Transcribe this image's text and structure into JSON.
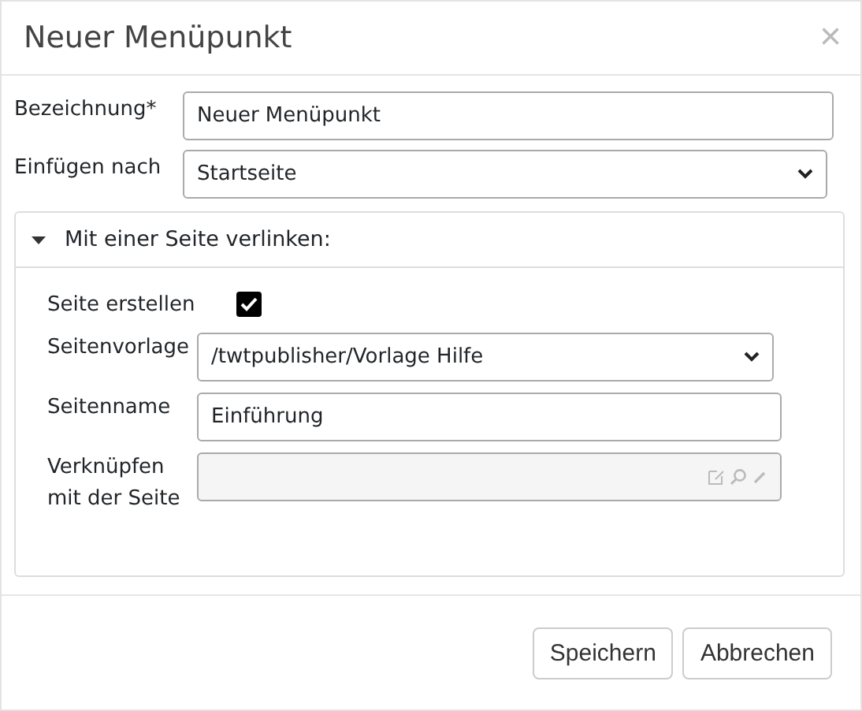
{
  "dialog": {
    "title": "Neuer Menüpunkt",
    "close": "×"
  },
  "fields": [
    {
      "kind": "text",
      "label": "Bezeichnung*",
      "value": "Neuer Menüpunkt"
    },
    {
      "kind": "select",
      "label": "Einfügen nach",
      "value": "Startseite"
    }
  ],
  "panel": {
    "title": "Mit einer Seite verlinken:",
    "expanded": true,
    "rows": [
      {
        "kind": "checkbox",
        "label": "Seite erstellen",
        "checked": true
      },
      {
        "kind": "select",
        "label": "Seitenvorlage",
        "value": "/twtpublisher/Vorlage Hilfe"
      },
      {
        "kind": "text",
        "label": "Seitenname",
        "value": "Einführung"
      },
      {
        "kind": "picker",
        "label": "Verknüpfen mit der Seite",
        "disabled": true
      }
    ]
  },
  "buttons": [
    "Speichern",
    "Abbrechen"
  ]
}
